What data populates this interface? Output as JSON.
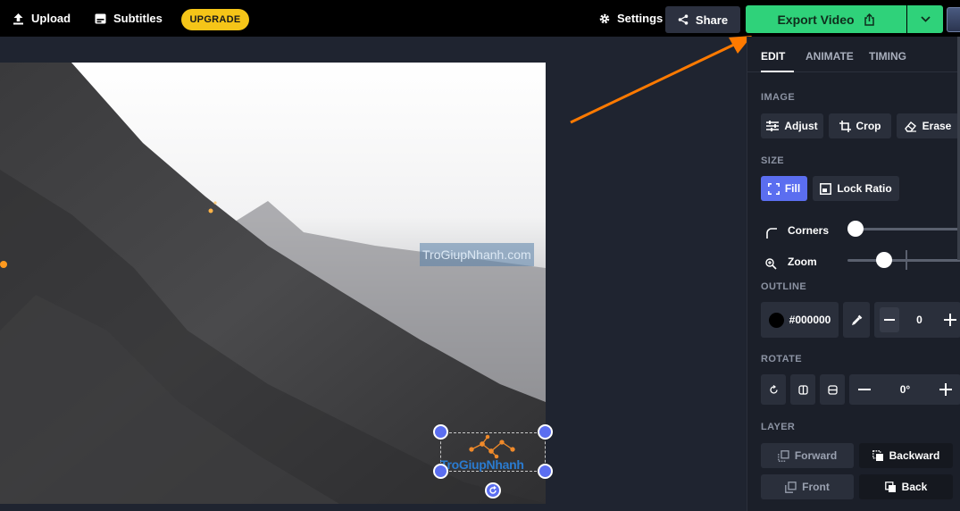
{
  "topbar": {
    "upload_label": "Upload",
    "subtitles_label": "Subtitles",
    "upgrade_label": "UPGRADE",
    "settings_label": "Settings",
    "share_label": "Share",
    "export_label": "Export Video",
    "upgrade_color": "#f5c518",
    "export_color": "#2fd27a"
  },
  "canvas": {
    "watermark_text": "TroGiupNhanh.com",
    "logo_text": "TroGiupNhanh"
  },
  "panel": {
    "tabs": [
      "EDIT",
      "ANIMATE",
      "TIMING"
    ],
    "image_label": "IMAGE",
    "image_buttons": [
      "Adjust",
      "Crop",
      "Erase"
    ],
    "size_label": "SIZE",
    "fill_label": "Fill",
    "lock_ratio_label": "Lock Ratio",
    "corners_label": "Corners",
    "zoom_label": "Zoom",
    "outline_label": "OUTLINE",
    "outline_color": "#000000",
    "outline_width": "0",
    "rotate_label": "ROTATE",
    "rotate_value": "0°",
    "layer_label": "LAYER",
    "layer_buttons": [
      "Forward",
      "Backward",
      "Front",
      "Back"
    ],
    "accent_color": "#5b6ef0"
  }
}
